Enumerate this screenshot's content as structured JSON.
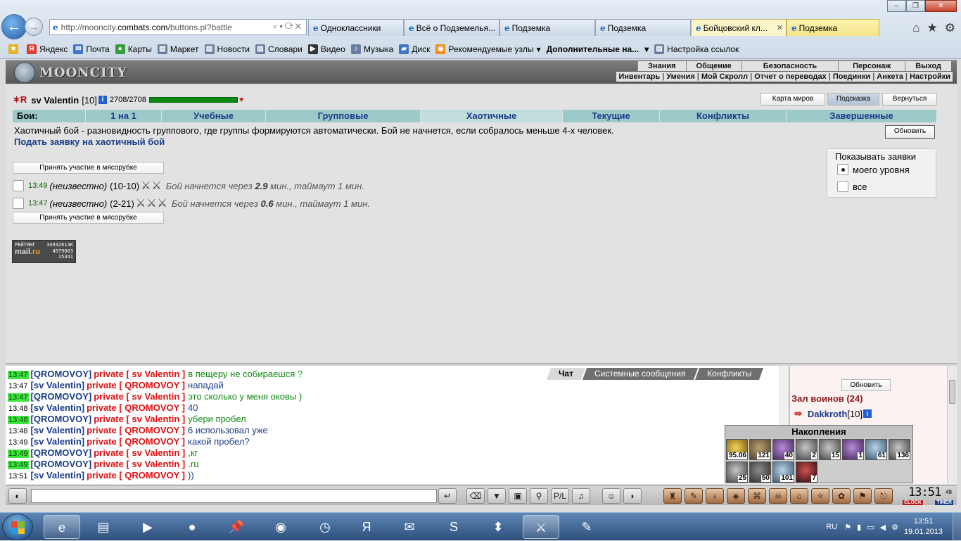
{
  "browser": {
    "url_prefix": "http://mooncity.",
    "url_domain": "combats.com",
    "url_suffix": "/buttons.pl?battle",
    "tabs": [
      {
        "label": "Одноклассники"
      },
      {
        "label": "Всё о Подземелья..."
      },
      {
        "label": "Подземка"
      },
      {
        "label": "Подземка"
      },
      {
        "label": "Бойцовский кл..."
      },
      {
        "label": "Подземка"
      }
    ],
    "favorites": [
      {
        "label": "Яндекс"
      },
      {
        "label": "Почта"
      },
      {
        "label": "Карты"
      },
      {
        "label": "Маркет"
      },
      {
        "label": "Новости"
      },
      {
        "label": "Словари"
      },
      {
        "label": "Видео"
      },
      {
        "label": "Музыка"
      },
      {
        "label": "Диск"
      },
      {
        "label": "Рекомендуемые узлы"
      },
      {
        "label": "Дополнительные на..."
      },
      {
        "label": "Настройка ссылок"
      }
    ]
  },
  "game": {
    "logo": "MOONCITY",
    "menu_top": [
      "Знания",
      "Общение",
      "Безопасность",
      "Персонаж",
      "Выход"
    ],
    "menu_bottom": [
      "Инвентарь",
      "Умения",
      "Мой Скролл",
      "Отчет о переводах",
      "Поединки",
      "Анкета",
      "Настройки"
    ]
  },
  "player": {
    "name": "sv Valentin",
    "level": "[10]",
    "hp": "2708/2708"
  },
  "top_buttons": {
    "map": "Карта миров",
    "hint": "Подсказка",
    "back": "Вернуться"
  },
  "battle_tabs": {
    "label": "Бои:",
    "items": [
      "1 на 1",
      "Учебные",
      "Групповые",
      "Хаотичные",
      "Текущие",
      "Конфликты",
      "Завершенные"
    ]
  },
  "description": "Хаотичный бой - разновидность группового, где группы формируются автоматически. Бой не начнется, если собралось меньше 4-х человек.",
  "submit_link": "Подать заявку на хаотичный бой",
  "refresh": "Обновить",
  "join_button": "Принять участие в мясорубке",
  "filter": {
    "title": "Показывать заявки",
    "options": [
      "моего уровня",
      "все"
    ]
  },
  "requests": [
    {
      "time": "13:49",
      "who": "(неизвестно)",
      "range": "(10-10)",
      "status_prefix": "Бой начнется через",
      "minutes": "2.9",
      "status_suffix": "мин., таймаут 1 мин."
    },
    {
      "time": "13:47",
      "who": "(неизвестно)",
      "range": "(2-21)",
      "status_prefix": "Бой начнется через",
      "minutes": "0.6",
      "status_suffix": "мин., таймаут 1 мин."
    }
  ],
  "rating_counter": {
    "label": "РЕЙТИНГ",
    "value": "34932614K",
    "brand": "mail",
    "brand_tld": ".ru",
    "n1": "4579603",
    "n2": "15341"
  },
  "chat": {
    "tabs": [
      "Чат",
      "Системные сообщения",
      "Конфликты"
    ],
    "messages": [
      {
        "time": "13:47",
        "from": "[QROMOVOY]",
        "to": "private [ sv Valentin ]",
        "text": "в пещеру не собираешся ?"
      },
      {
        "time": "13:47",
        "from": "[sv Valentin]",
        "to": "private [ QROMOVOY ]",
        "text": "нападай"
      },
      {
        "time": "13:47",
        "from": "[QROMOVOY]",
        "to": "private [ sv Valentin ]",
        "text": "это сколько у меня оковы )"
      },
      {
        "time": "13:48",
        "from": "[sv Valentin]",
        "to": "private [ QROMOVOY ]",
        "text": "40"
      },
      {
        "time": "13:48",
        "from": "[QROMOVOY]",
        "to": "private [ sv Valentin ]",
        "text": "убери пробел"
      },
      {
        "time": "13:48",
        "from": "[sv Valentin]",
        "to": "private [ QROMOVOY ]",
        "text": "6 использовал уже"
      },
      {
        "time": "13:49",
        "from": "[sv Valentin]",
        "to": "private [ QROMOVOY ]",
        "text": "какой пробел?"
      },
      {
        "time": "13:49",
        "from": "[QROMOVOY]",
        "to": "private [ sv Valentin ]",
        "text": ",кг"
      },
      {
        "time": "13:49",
        "from": "[QROMOVOY]",
        "to": "private [ sv Valentin ]",
        "text": ".ru"
      },
      {
        "time": "13:51",
        "from": "[sv Valentin]",
        "to": "private [ QROMOVOY ]",
        "text": "))"
      }
    ]
  },
  "side": {
    "refresh": "Обновить",
    "hall": "Зал воинов (24)",
    "warrior_name": "Dakkroth",
    "warrior_level": "[10]"
  },
  "accum": {
    "title": "Накопления",
    "items": [
      "95.06",
      "121",
      "40",
      "2",
      "15",
      "1",
      "61",
      "136",
      "25",
      "50",
      "101",
      "7"
    ]
  },
  "clock": {
    "time": "13:51",
    "seconds": "48",
    "label1": "CLOCK",
    "label2": "TIMER"
  },
  "tray": {
    "lang": "RU",
    "time": "13:51",
    "date": "19.01.2013"
  }
}
